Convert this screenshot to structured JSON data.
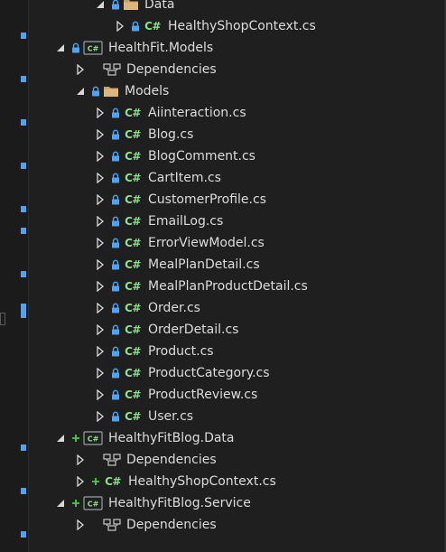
{
  "solution_explorer": {
    "rows": [
      {
        "label": "Data",
        "level": 3,
        "expander": "expanded",
        "badge": "lock",
        "icon": "folder-icon"
      },
      {
        "label": "HealthyShopContext.cs",
        "level": 4,
        "expander": "collapsed",
        "badge": "lock",
        "icon": "csharp-file-icon"
      },
      {
        "label": "HealthFit.Models",
        "level": 1,
        "expander": "expanded",
        "badge": "lock",
        "icon": "csharp-project-icon"
      },
      {
        "label": "Dependencies",
        "level": 2,
        "expander": "collapsed",
        "badge": "",
        "icon": "dependencies-icon"
      },
      {
        "label": "Models",
        "level": 2,
        "expander": "expanded",
        "badge": "lock",
        "icon": "folder-icon"
      },
      {
        "label": "Aiinteraction.cs",
        "level": 3,
        "expander": "collapsed",
        "badge": "lock",
        "icon": "csharp-file-icon"
      },
      {
        "label": "Blog.cs",
        "level": 3,
        "expander": "collapsed",
        "badge": "lock",
        "icon": "csharp-file-icon"
      },
      {
        "label": "BlogComment.cs",
        "level": 3,
        "expander": "collapsed",
        "badge": "lock",
        "icon": "csharp-file-icon"
      },
      {
        "label": "CartItem.cs",
        "level": 3,
        "expander": "collapsed",
        "badge": "lock",
        "icon": "csharp-file-icon"
      },
      {
        "label": "CustomerProfile.cs",
        "level": 3,
        "expander": "collapsed",
        "badge": "lock",
        "icon": "csharp-file-icon"
      },
      {
        "label": "EmailLog.cs",
        "level": 3,
        "expander": "collapsed",
        "badge": "lock",
        "icon": "csharp-file-icon"
      },
      {
        "label": "ErrorViewModel.cs",
        "level": 3,
        "expander": "collapsed",
        "badge": "lock",
        "icon": "csharp-file-icon"
      },
      {
        "label": "MealPlanDetail.cs",
        "level": 3,
        "expander": "collapsed",
        "badge": "lock",
        "icon": "csharp-file-icon"
      },
      {
        "label": "MealPlanProductDetail.cs",
        "level": 3,
        "expander": "collapsed",
        "badge": "lock",
        "icon": "csharp-file-icon"
      },
      {
        "label": "Order.cs",
        "level": 3,
        "expander": "collapsed",
        "badge": "lock",
        "icon": "csharp-file-icon"
      },
      {
        "label": "OrderDetail.cs",
        "level": 3,
        "expander": "collapsed",
        "badge": "lock",
        "icon": "csharp-file-icon"
      },
      {
        "label": "Product.cs",
        "level": 3,
        "expander": "collapsed",
        "badge": "lock",
        "icon": "csharp-file-icon"
      },
      {
        "label": "ProductCategory.cs",
        "level": 3,
        "expander": "collapsed",
        "badge": "lock",
        "icon": "csharp-file-icon"
      },
      {
        "label": "ProductReview.cs",
        "level": 3,
        "expander": "collapsed",
        "badge": "lock",
        "icon": "csharp-file-icon"
      },
      {
        "label": "User.cs",
        "level": 3,
        "expander": "collapsed",
        "badge": "lock",
        "icon": "csharp-file-icon"
      },
      {
        "label": "HealthyFitBlog.Data",
        "level": 1,
        "expander": "expanded",
        "badge": "plus",
        "icon": "csharp-project-icon"
      },
      {
        "label": "Dependencies",
        "level": 2,
        "expander": "collapsed",
        "badge": "",
        "icon": "dependencies-icon"
      },
      {
        "label": "HealthyShopContext.cs",
        "level": 2,
        "expander": "collapsed",
        "badge": "plus",
        "icon": "csharp-file-icon"
      },
      {
        "label": "HealthyFitBlog.Service",
        "level": 1,
        "expander": "expanded",
        "badge": "plus",
        "icon": "csharp-project-icon"
      },
      {
        "label": "Dependencies",
        "level": 2,
        "expander": "collapsed",
        "badge": "",
        "icon": "dependencies-icon"
      }
    ],
    "csharp_glyph": "C#",
    "colors": {
      "background": "#1f1f1f",
      "text": "#dcdcdc",
      "lock_badge": "#4ea3f7",
      "plus_badge": "#4ec94e",
      "csharp_glyph": "#8be08b",
      "folder": "#dcb67a",
      "gutter_marker": "#4ea3f7"
    }
  }
}
